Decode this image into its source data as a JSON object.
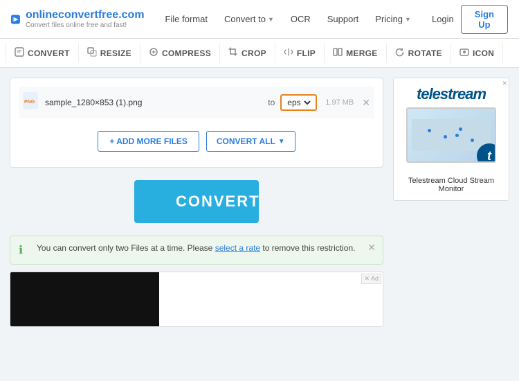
{
  "header": {
    "logo_title": "onlineconvertfree.com",
    "logo_sub": "Convert files online free and fast!",
    "nav": [
      {
        "label": "File format",
        "has_arrow": false
      },
      {
        "label": "Convert to",
        "has_arrow": true
      },
      {
        "label": "OCR",
        "has_arrow": false
      },
      {
        "label": "Support",
        "has_arrow": false
      },
      {
        "label": "Pricing",
        "has_arrow": true
      }
    ],
    "login_label": "Login",
    "signup_label": "Sign Up"
  },
  "toolbar": {
    "items": [
      {
        "label": "CONVERT",
        "icon": "⬜"
      },
      {
        "label": "RESIZE",
        "icon": "⬜"
      },
      {
        "label": "COMPRESS",
        "icon": "⬜"
      },
      {
        "label": "CROP",
        "icon": "⬜"
      },
      {
        "label": "FLIP",
        "icon": "⬜"
      },
      {
        "label": "MERGE",
        "icon": "⬜"
      },
      {
        "label": "ROTATE",
        "icon": "⬜"
      },
      {
        "label": "ICON",
        "icon": "⬜"
      }
    ]
  },
  "file_panel": {
    "file_name": "sample_1280×853 (1).png",
    "to_label": "to",
    "format_value": "eps",
    "file_size": "1.97 MB",
    "remove_symbol": "✕",
    "add_files_label": "+ ADD MORE FILES",
    "convert_all_label": "CONVERT ALL",
    "convert_button_label": "CONVERT"
  },
  "info_bar": {
    "text_before_link": "You can convert only two Files at a time. Please ",
    "link_text": "select a rate",
    "text_after_link": " to remove this restriction.",
    "close_symbol": "✕"
  },
  "ad_right": {
    "badge": "✕",
    "logo": "telestream",
    "description": "Telestream Cloud Stream Monitor"
  }
}
